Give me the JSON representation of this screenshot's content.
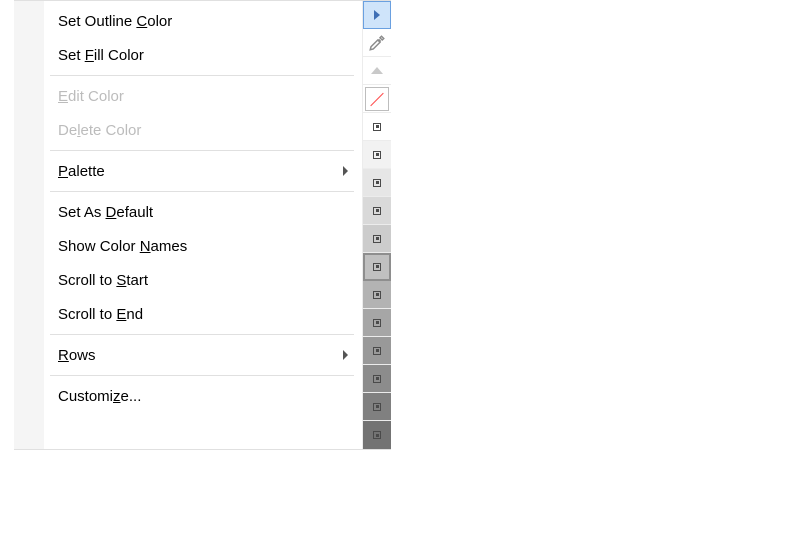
{
  "menu": {
    "setOutlineColor": {
      "pre": "Set Outline ",
      "m": "C",
      "post": "olor"
    },
    "setFillColor": {
      "pre": "Set ",
      "m": "F",
      "post": "ill Color"
    },
    "editColor": {
      "pre": "",
      "m": "E",
      "post": "dit Color"
    },
    "deleteColor": {
      "pre": "De",
      "m": "l",
      "post": "ete Color"
    },
    "palette": {
      "pre": "",
      "m": "P",
      "post": "alette"
    },
    "setAsDefault": {
      "pre": "Set As ",
      "m": "D",
      "post": "efault"
    },
    "showColorNames": {
      "pre": "Show Color ",
      "m": "N",
      "post": "ames"
    },
    "scrollToStart": {
      "pre": "Scroll to ",
      "m": "S",
      "post": "tart"
    },
    "scrollToEnd": {
      "pre": "Scroll to ",
      "m": "E",
      "post": "nd"
    },
    "rows": {
      "pre": "",
      "m": "R",
      "post": "ows"
    },
    "customize": {
      "pre": "Customi",
      "m": "z",
      "post": "e..."
    }
  },
  "palette": {
    "swatches": [
      {
        "type": "arrow-flyout",
        "highlight": true
      },
      {
        "type": "eyedropper"
      },
      {
        "type": "scroll-up"
      },
      {
        "type": "none"
      },
      {
        "type": "color",
        "bg": "#ffffff"
      },
      {
        "type": "color",
        "bg": "#f2f2f2"
      },
      {
        "type": "color",
        "bg": "#e6e6e6"
      },
      {
        "type": "color",
        "bg": "#d9d9d9"
      },
      {
        "type": "color",
        "bg": "#cccccc"
      },
      {
        "type": "color",
        "bg": "#c0c0c0",
        "selected": true
      },
      {
        "type": "color",
        "bg": "#b3b3b3"
      },
      {
        "type": "color",
        "bg": "#a6a6a6"
      },
      {
        "type": "color",
        "bg": "#999999"
      },
      {
        "type": "color",
        "bg": "#8c8c8c"
      },
      {
        "type": "color",
        "bg": "#808080"
      },
      {
        "type": "color",
        "bg": "#737373"
      }
    ]
  }
}
